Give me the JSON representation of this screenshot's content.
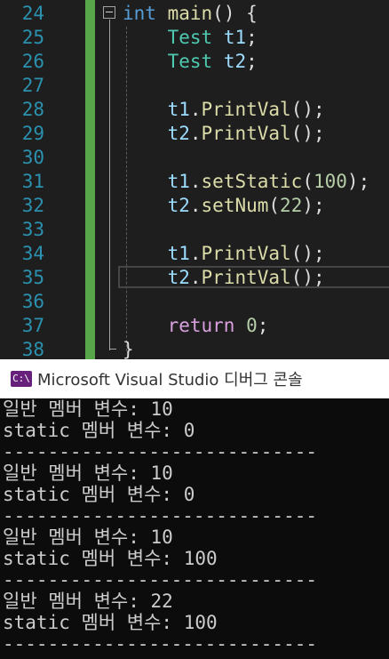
{
  "editor": {
    "line_numbers": [
      "24",
      "25",
      "26",
      "27",
      "28",
      "29",
      "30",
      "31",
      "32",
      "33",
      "34",
      "35",
      "36",
      "37",
      "38"
    ],
    "code": [
      [
        {
          "t": "kw",
          "v": "int"
        },
        {
          "t": "pl",
          "v": " "
        },
        {
          "t": "fn",
          "v": "main"
        },
        {
          "t": "pl",
          "v": "() {"
        }
      ],
      [
        {
          "t": "pl",
          "v": "    "
        },
        {
          "t": "ty",
          "v": "Test"
        },
        {
          "t": "pl",
          "v": " "
        },
        {
          "t": "va",
          "v": "t1"
        },
        {
          "t": "pl",
          "v": ";"
        }
      ],
      [
        {
          "t": "pl",
          "v": "    "
        },
        {
          "t": "ty",
          "v": "Test"
        },
        {
          "t": "pl",
          "v": " "
        },
        {
          "t": "va",
          "v": "t2"
        },
        {
          "t": "pl",
          "v": ";"
        }
      ],
      [],
      [
        {
          "t": "pl",
          "v": "    "
        },
        {
          "t": "va",
          "v": "t1"
        },
        {
          "t": "pl",
          "v": "."
        },
        {
          "t": "fn",
          "v": "PrintVal"
        },
        {
          "t": "pl",
          "v": "();"
        }
      ],
      [
        {
          "t": "pl",
          "v": "    "
        },
        {
          "t": "va",
          "v": "t2"
        },
        {
          "t": "pl",
          "v": "."
        },
        {
          "t": "fn",
          "v": "PrintVal"
        },
        {
          "t": "pl",
          "v": "();"
        }
      ],
      [],
      [
        {
          "t": "pl",
          "v": "    "
        },
        {
          "t": "va",
          "v": "t1"
        },
        {
          "t": "pl",
          "v": "."
        },
        {
          "t": "fn",
          "v": "setStatic"
        },
        {
          "t": "pl",
          "v": "("
        },
        {
          "t": "nu",
          "v": "100"
        },
        {
          "t": "pl",
          "v": ");"
        }
      ],
      [
        {
          "t": "pl",
          "v": "    "
        },
        {
          "t": "va",
          "v": "t2"
        },
        {
          "t": "pl",
          "v": "."
        },
        {
          "t": "fn",
          "v": "setNum"
        },
        {
          "t": "pl",
          "v": "("
        },
        {
          "t": "nu",
          "v": "22"
        },
        {
          "t": "pl",
          "v": ");"
        }
      ],
      [],
      [
        {
          "t": "pl",
          "v": "    "
        },
        {
          "t": "va",
          "v": "t1"
        },
        {
          "t": "pl",
          "v": "."
        },
        {
          "t": "fn",
          "v": "PrintVal"
        },
        {
          "t": "pl",
          "v": "();"
        }
      ],
      [
        {
          "t": "pl",
          "v": "    "
        },
        {
          "t": "va",
          "v": "t2"
        },
        {
          "t": "pl",
          "v": "."
        },
        {
          "t": "fn",
          "v": "PrintVal"
        },
        {
          "t": "pl",
          "v": "();"
        }
      ],
      [],
      [
        {
          "t": "pl",
          "v": "    "
        },
        {
          "t": "ct",
          "v": "return"
        },
        {
          "t": "pl",
          "v": " "
        },
        {
          "t": "nu",
          "v": "0"
        },
        {
          "t": "pl",
          "v": ";"
        }
      ],
      [
        {
          "t": "pl",
          "v": "}"
        }
      ]
    ],
    "current_line": "35"
  },
  "console": {
    "icon_text": "C:\\",
    "title": "Microsoft Visual Studio 디버그 콘솔",
    "lines": [
      "일반 멤버 변수: 10",
      "static 멤버 변수: 0",
      "----------------------------",
      "일반 멤버 변수: 10",
      "static 멤버 변수: 0",
      "----------------------------",
      "일반 멤버 변수: 10",
      "static 멤버 변수: 100",
      "----------------------------",
      "일반 멤버 변수: 22",
      "static 멤버 변수: 100",
      "----------------------------"
    ]
  },
  "colors": {
    "editor_background": "#1e1e1e",
    "line_number": "#2b91af",
    "keyword": "#569cd6",
    "type": "#4ec9b0",
    "function": "#dcdcaa",
    "variable": "#9cdcfe",
    "number": "#b5cea8",
    "control_keyword": "#d8a0df",
    "change_bar": "#57a64a",
    "console_background": "#0c0c0c",
    "console_text": "#cccccc"
  }
}
